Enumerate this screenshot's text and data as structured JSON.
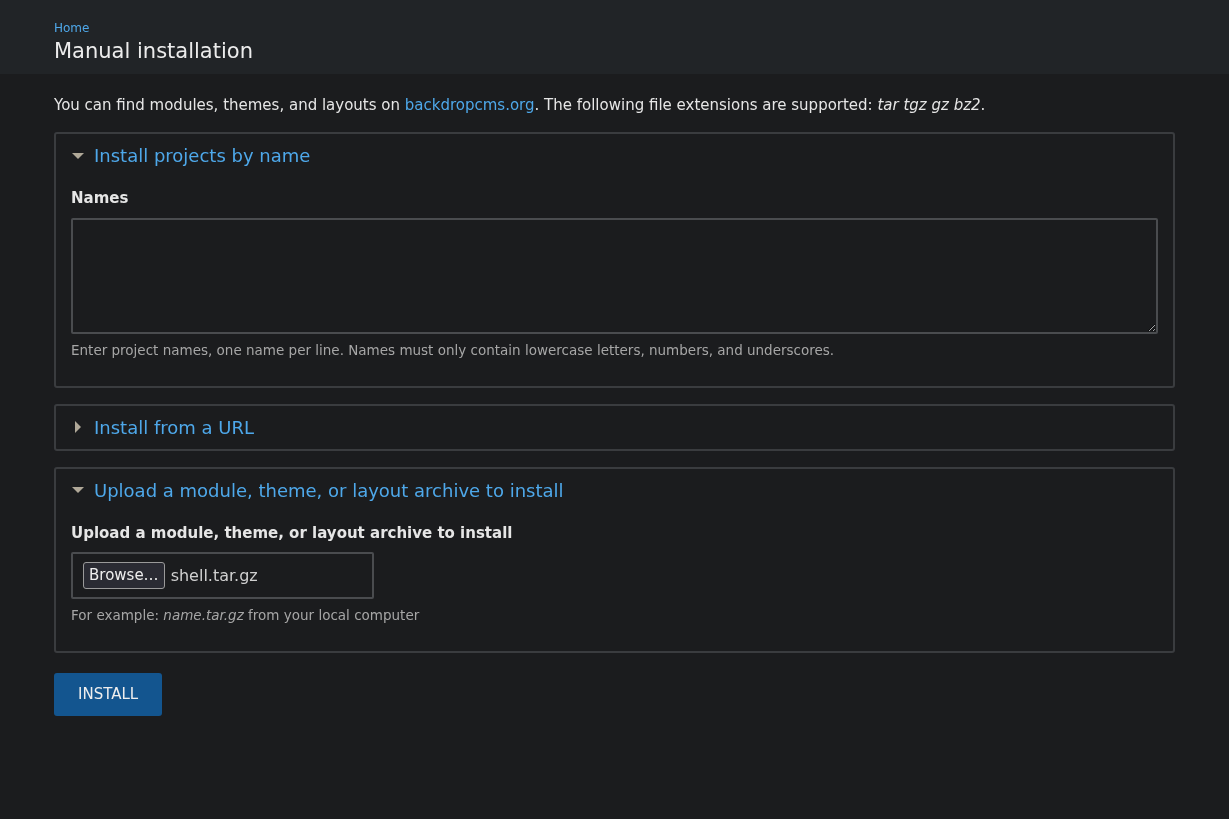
{
  "breadcrumb": "Home",
  "title": "Manual installation",
  "intro": {
    "before": "You can find modules, themes, and layouts on ",
    "link": "backdropcms.org",
    "after": ". The following file extensions are supported: *tar tgz gz bz2*."
  },
  "sections": [
    {
      "title": "Install projects by name",
      "expanded": true,
      "kind": "textarea",
      "label": "Names",
      "help": "Enter project names, one name per line. Names must only contain lowercase letters, numbers, and underscores."
    },
    {
      "title": "Install from a URL",
      "expanded": false
    },
    {
      "title": "Upload a module, theme, or layout archive to install",
      "expanded": true,
      "kind": "file",
      "label": "Upload a module, theme, or layout archive to install",
      "browse": "Browse…",
      "file": "shell.tar.gz",
      "help": "For example: *name.tar.gz* from your local computer"
    }
  ],
  "submit": "INSTALL"
}
